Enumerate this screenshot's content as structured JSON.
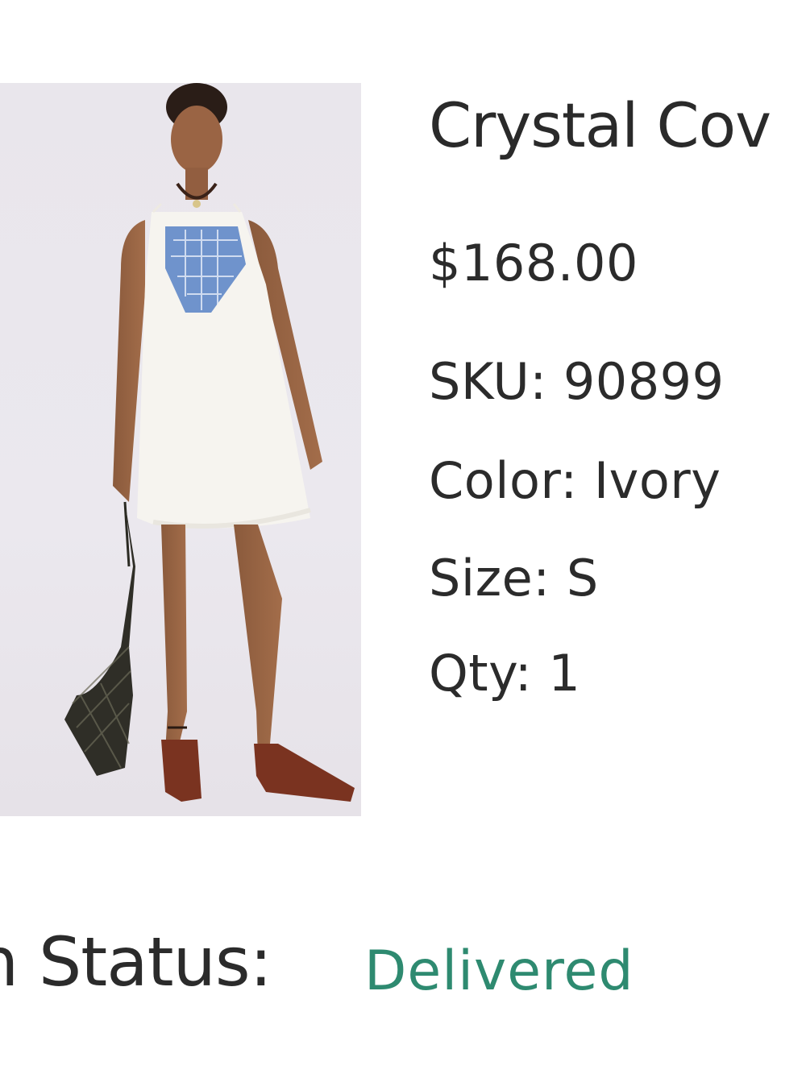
{
  "product": {
    "image_alt": "Model wearing white mini dress with blue embroidered bib",
    "title": "Crystal Cov",
    "price": "$168.00",
    "sku": "SKU: 90899",
    "color": "Color: Ivory",
    "size": "Size: S",
    "qty": "Qty: 1"
  },
  "status": {
    "label": "n Status:",
    "value": "Delivered",
    "value_color": "#2e8a70"
  }
}
